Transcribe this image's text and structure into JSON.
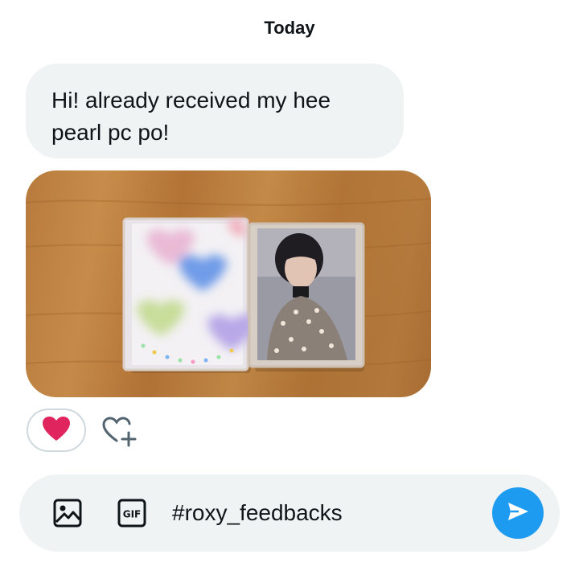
{
  "date_header": "Today",
  "message": {
    "text": "Hi! already received my hee pearl pc po!"
  },
  "reactions": {
    "current": "❤️"
  },
  "composer": {
    "input_value": "#roxy_feedbacks"
  },
  "icons": {
    "media": "image-icon",
    "gif": "gif-icon",
    "add_reaction": "heart-plus-icon",
    "send": "send-arrow-icon"
  },
  "colors": {
    "accent": "#1d9bf0",
    "bubble": "#eff3f4",
    "heart": "#e0245e"
  }
}
